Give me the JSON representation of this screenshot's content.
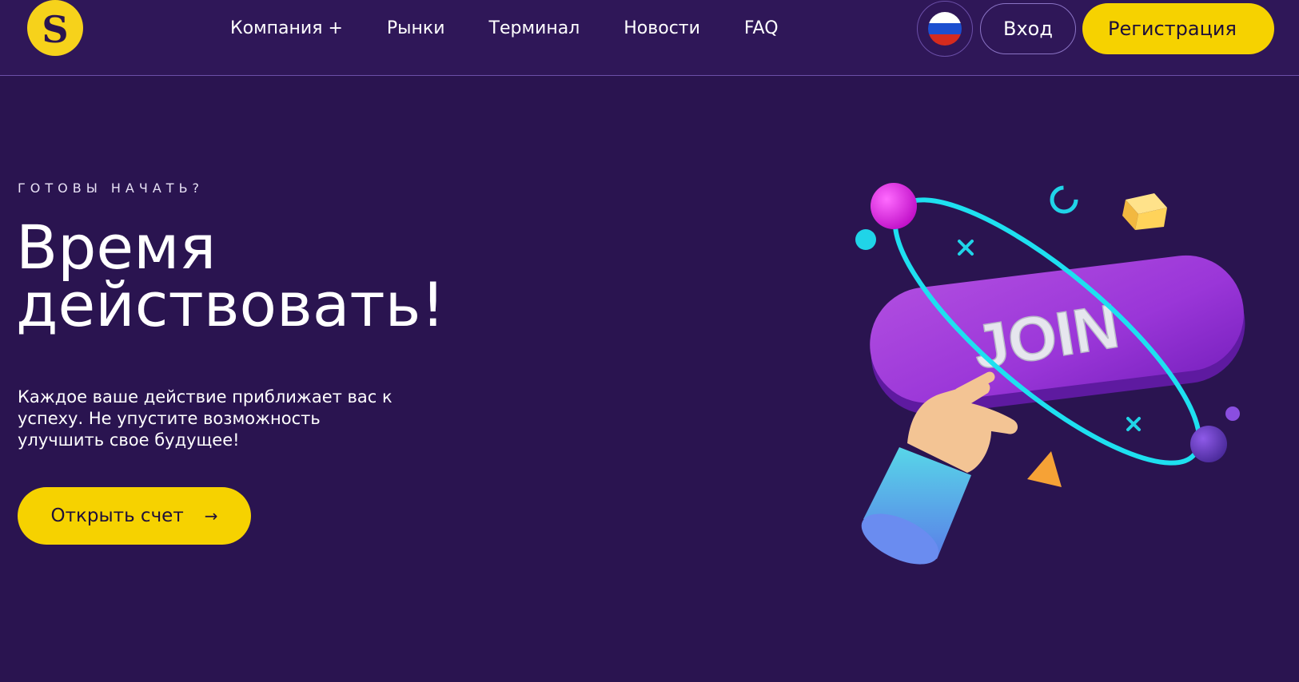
{
  "header": {
    "logo_letter": "S",
    "nav": [
      "Компания +",
      "Рынки",
      "Терминал",
      "Новости",
      "FAQ"
    ],
    "login_label": "Вход",
    "register_label": "Регистрация",
    "language_icon": "russia-flag-icon"
  },
  "hero": {
    "eyebrow": "ГОТОВЫ НАЧАТЬ?",
    "headline_line1": "Время",
    "headline_line2": "действовать!",
    "description": "Каждое ваше действие приближает вас к успеху. Не упустите возможность улучшить свое будущее!",
    "cta_label": "Открыть счет",
    "cta_icon": "arrow-right-icon"
  },
  "illustration": {
    "button_text": "JOIN"
  },
  "colors": {
    "background": "#2a1450",
    "accent": "#f6d200",
    "flag_white": "#ffffff",
    "flag_blue": "#1c4fd0",
    "flag_red": "#d52b1e"
  }
}
